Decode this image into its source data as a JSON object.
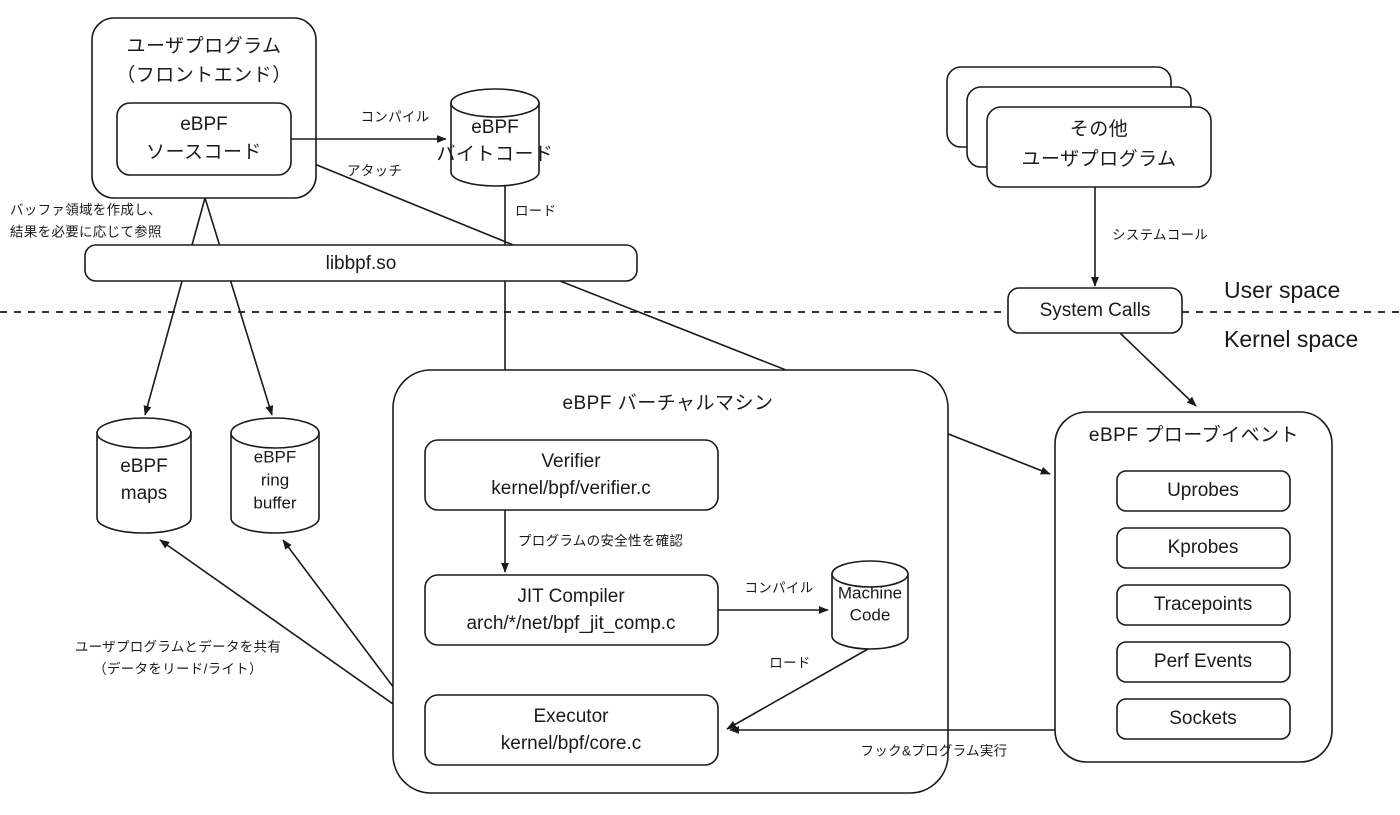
{
  "diagram": {
    "title": "eBPF architecture overview",
    "language": "ja",
    "colors": {
      "stroke": "#1a1a1a",
      "fill": "#ffffff",
      "background": "#ffffff"
    }
  },
  "regions": {
    "user_space": "User space",
    "kernel_space": "Kernel space"
  },
  "nodes": {
    "user_program": {
      "line1": "ユーザプログラム",
      "line2": "（フロントエンド）"
    },
    "ebpf_source": {
      "line1": "eBPF",
      "line2": "ソースコード"
    },
    "ebpf_bytecode": {
      "line1": "eBPF",
      "line2": "バイトコード"
    },
    "libbpf": {
      "label": "libbpf.so"
    },
    "other_user_programs": {
      "line1": "その他",
      "line2": "ユーザプログラム"
    },
    "system_calls": {
      "label": "System Calls"
    },
    "ebpf_maps": {
      "line1": "eBPF",
      "line2": "maps"
    },
    "ebpf_ring_buffer": {
      "line1": "eBPF",
      "line2": "ring",
      "line3": "buffer"
    },
    "vm_container": {
      "title": "eBPF バーチャルマシン"
    },
    "verifier": {
      "line1": "Verifier",
      "line2": "kernel/bpf/verifier.c"
    },
    "jit_compiler": {
      "line1": "JIT Compiler",
      "line2": "arch/*/net/bpf_jit_comp.c"
    },
    "machine_code": {
      "line1": "Machine",
      "line2": "Code"
    },
    "executor": {
      "line1": "Executor",
      "line2": "kernel/bpf/core.c"
    },
    "probe_container": {
      "title": "eBPF プローブイベント"
    },
    "probes": [
      {
        "label": "Uprobes"
      },
      {
        "label": "Kprobes"
      },
      {
        "label": "Tracepoints"
      },
      {
        "label": "Perf Events"
      },
      {
        "label": "Sockets"
      }
    ]
  },
  "edge_labels": {
    "compile_source_to_bytecode": "コンパイル",
    "attach": "アタッチ",
    "load_bytecode": "ロード",
    "buffer_note_line1": "バッファ領域を作成し、",
    "buffer_note_line2": "結果を必要に応じて参照",
    "syscall": "システムコール",
    "verify_safety": "プログラムの安全性を確認",
    "compile_jit_to_machine": "コンパイル",
    "load_machine_code": "ロード",
    "hook_and_run": "フック&プログラム実行",
    "share_data_line1": "ユーザプログラムとデータを共有",
    "share_data_line2": "（データをリード/ライト）"
  }
}
